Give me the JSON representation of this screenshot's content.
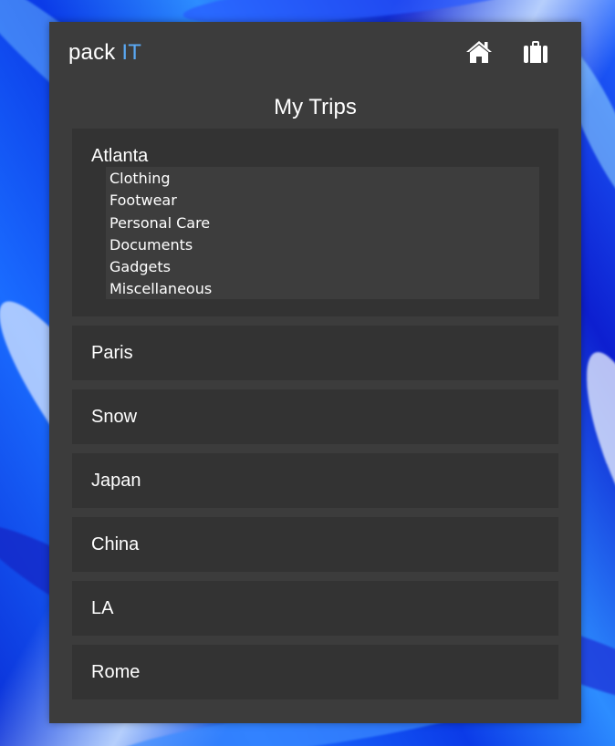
{
  "app": {
    "brand_prefix": "pack",
    "brand_accent": "IT",
    "accent_color": "#5aa9f4",
    "nav": [
      {
        "icon": "home-icon"
      },
      {
        "icon": "luggage-icon"
      }
    ]
  },
  "page": {
    "title": "My Trips"
  },
  "trips": [
    {
      "name": "Atlanta",
      "expanded": true,
      "categories": [
        "Clothing",
        "Footwear",
        "Personal Care",
        "Documents",
        "Gadgets",
        "Miscellaneous"
      ]
    },
    {
      "name": "Paris",
      "expanded": false
    },
    {
      "name": "Snow",
      "expanded": false
    },
    {
      "name": "Japan",
      "expanded": false
    },
    {
      "name": "China",
      "expanded": false
    },
    {
      "name": "LA",
      "expanded": false
    },
    {
      "name": "Rome",
      "expanded": false
    }
  ]
}
